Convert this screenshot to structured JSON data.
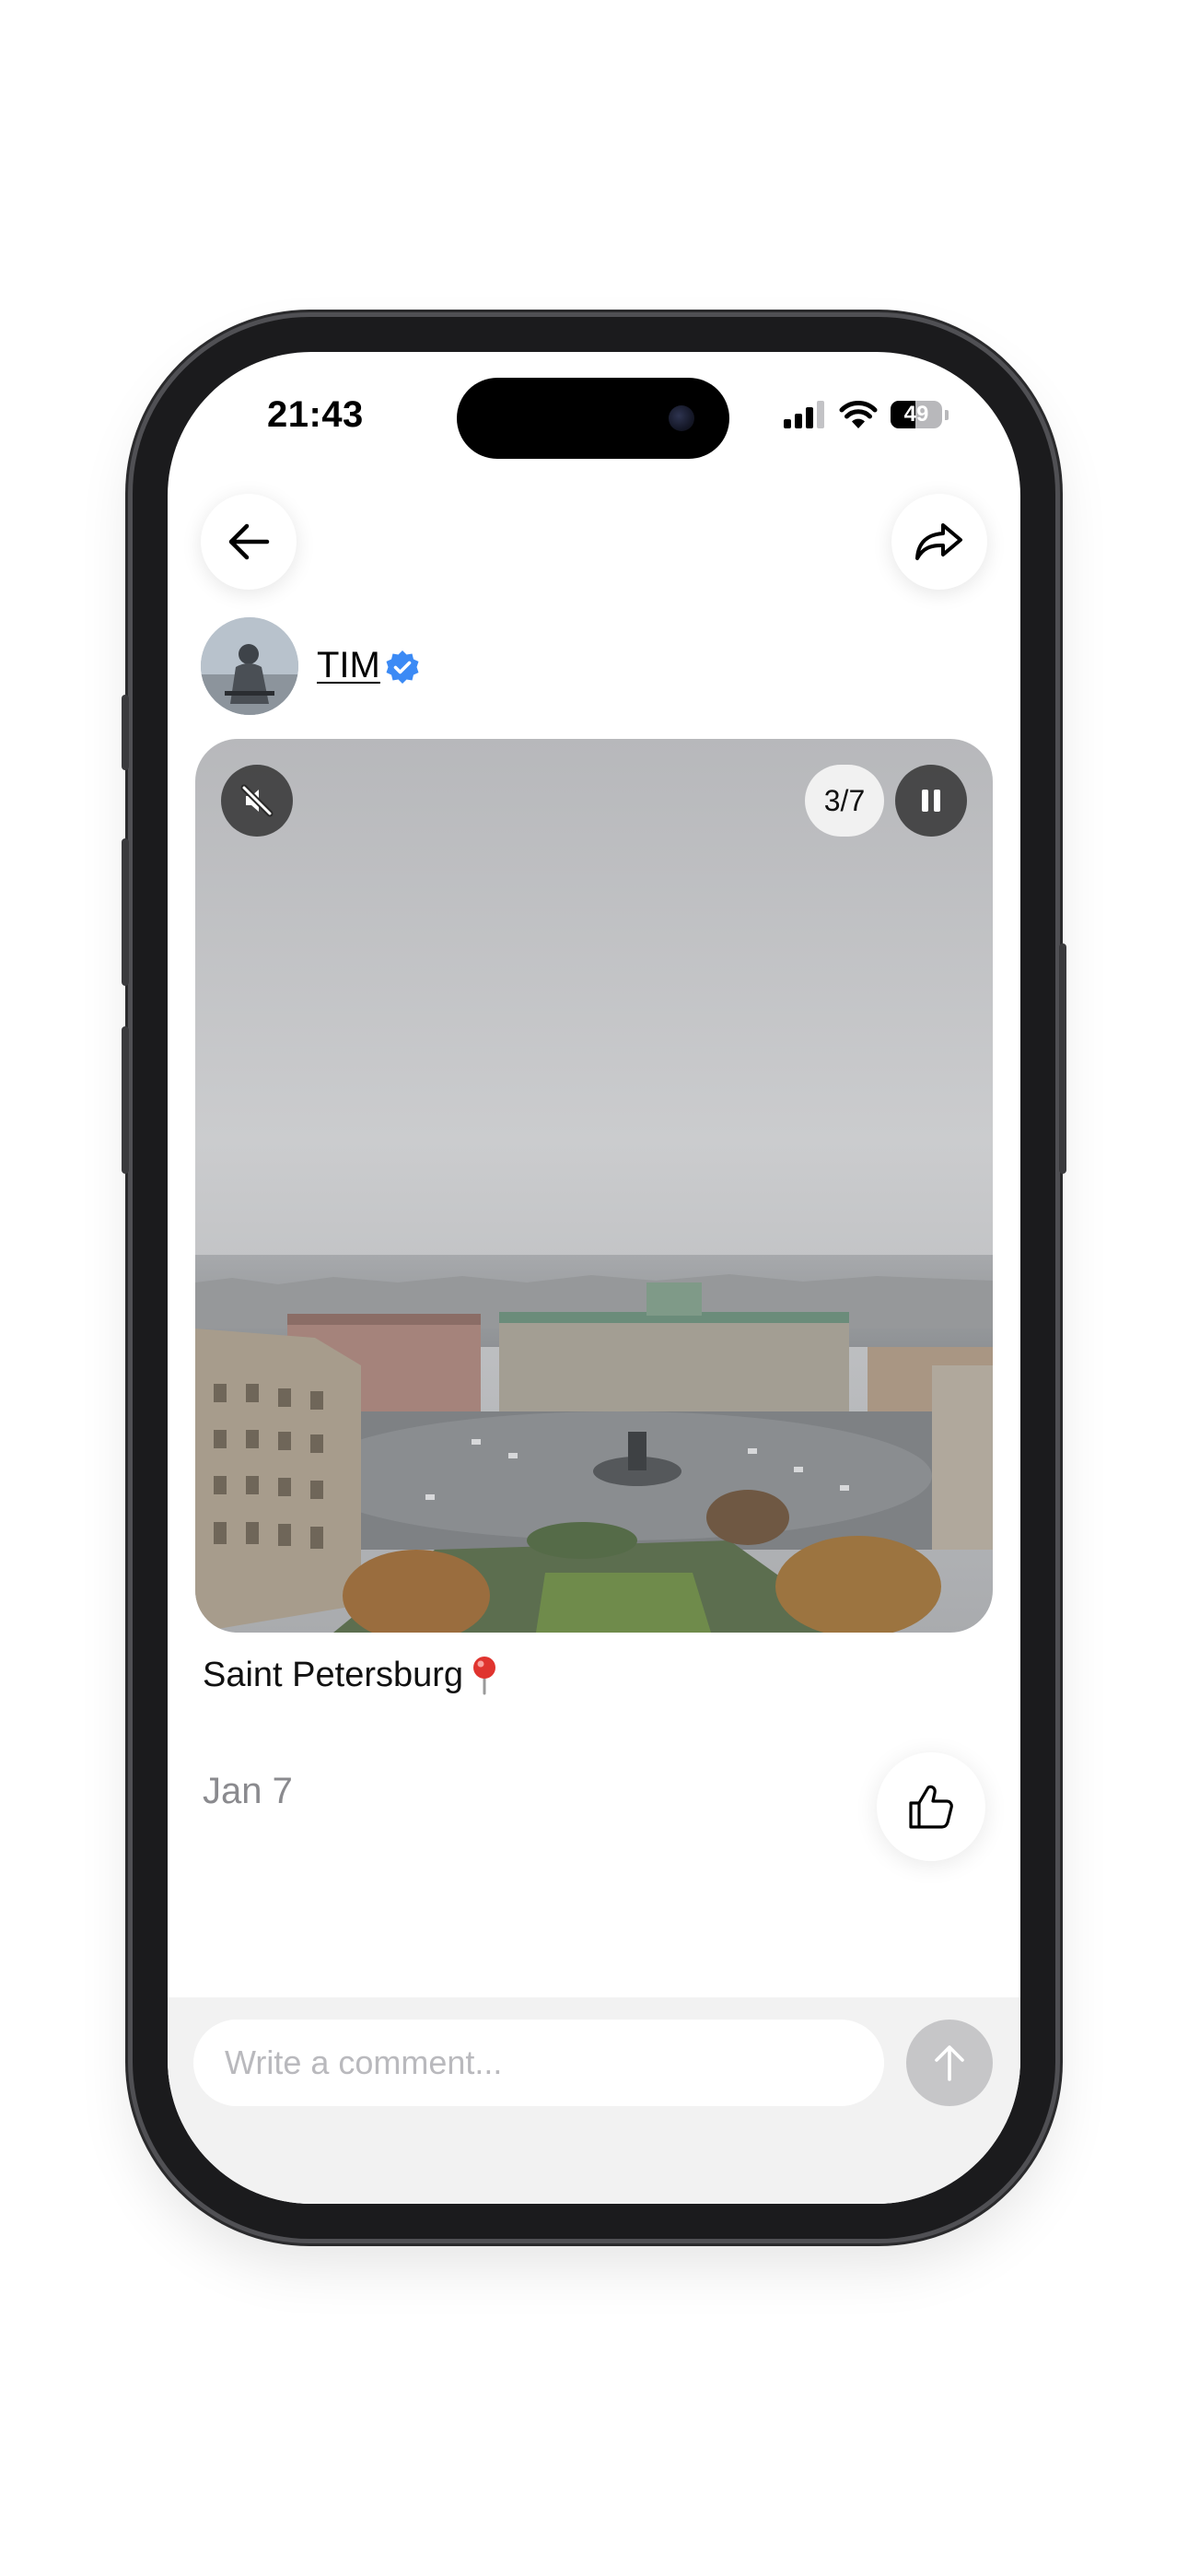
{
  "status_bar": {
    "time": "21:43",
    "battery_percent": "49",
    "battery_level": 0.49,
    "icons": [
      "cellular-signal-icon",
      "wifi-icon",
      "battery-icon"
    ]
  },
  "nav": {
    "back_icon": "arrow-left-icon",
    "share_icon": "share-arrow-icon"
  },
  "author": {
    "name": "TIM",
    "verified": true,
    "verified_color": "#3b8af5"
  },
  "media": {
    "counter": "3/7",
    "current_index": 3,
    "total": 7,
    "mute_icon": "speaker-muted-icon",
    "pause_icon": "pause-icon"
  },
  "post": {
    "location": "Saint Petersburg",
    "location_icon": "round-pushpin-icon",
    "date": "Jan 7",
    "like_icon": "thumbs-up-icon"
  },
  "comment": {
    "placeholder": "Write a comment...",
    "value": "",
    "send_icon": "arrow-up-icon"
  }
}
